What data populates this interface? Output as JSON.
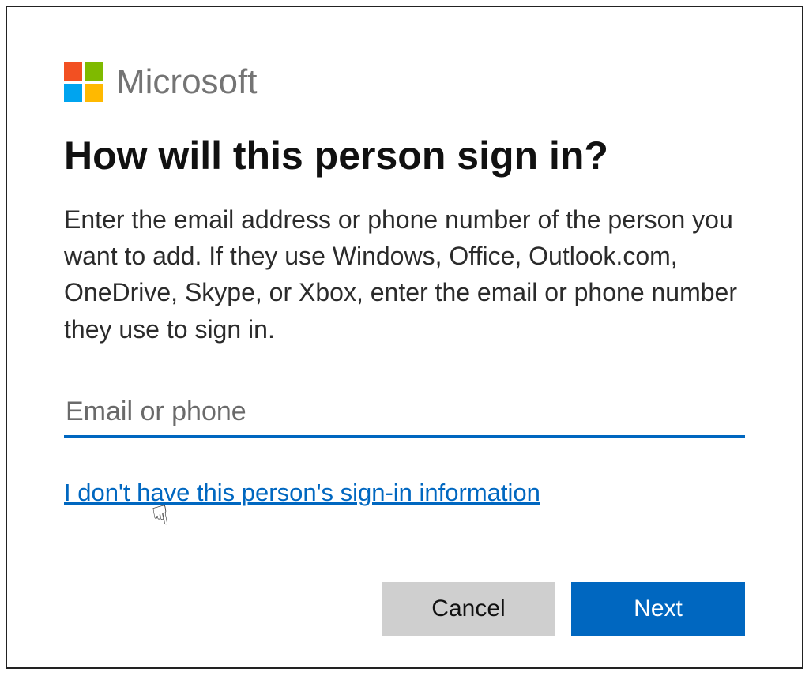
{
  "brand": {
    "name": "Microsoft",
    "logo_colors": {
      "tl": "#f25022",
      "tr": "#7fba00",
      "bl": "#00a4ef",
      "br": "#ffb900"
    }
  },
  "heading": "How will this person sign in?",
  "description": "Enter the email address or phone number of the person you want to add. If they use Windows, Office, Outlook.com, OneDrive, Skype, or Xbox, enter the email or phone number they use to sign in.",
  "input": {
    "value": "",
    "placeholder": "Email or phone"
  },
  "alt_link": "I don't have this person's sign-in information",
  "buttons": {
    "cancel": "Cancel",
    "next": "Next"
  },
  "colors": {
    "accent": "#0067c0",
    "button_secondary_bg": "#cfcfcf",
    "brand_text": "#747474"
  }
}
